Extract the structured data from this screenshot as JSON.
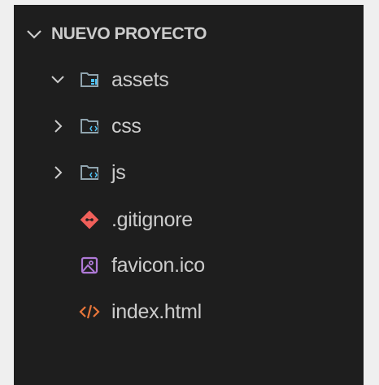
{
  "explorer": {
    "project_title": "NUEVO PROYECTO",
    "items": [
      {
        "label": "assets",
        "type": "folder",
        "expanded": true,
        "icon": "folder-assets-icon"
      },
      {
        "label": "css",
        "type": "folder",
        "expanded": false,
        "icon": "folder-css-icon"
      },
      {
        "label": "js",
        "type": "folder",
        "expanded": false,
        "icon": "folder-js-icon"
      },
      {
        "label": ".gitignore",
        "type": "file",
        "icon": "git-icon"
      },
      {
        "label": "favicon.ico",
        "type": "file",
        "icon": "image-file-icon"
      },
      {
        "label": "index.html",
        "type": "file",
        "icon": "html-file-icon"
      }
    ]
  },
  "colors": {
    "panel_background": "#1e1e1e",
    "text": "#cccccc",
    "folder_icon": "#90a4ae",
    "git_icon": "#f0605a",
    "image_icon": "#b07ad8",
    "html_icon": "#e8763a"
  }
}
